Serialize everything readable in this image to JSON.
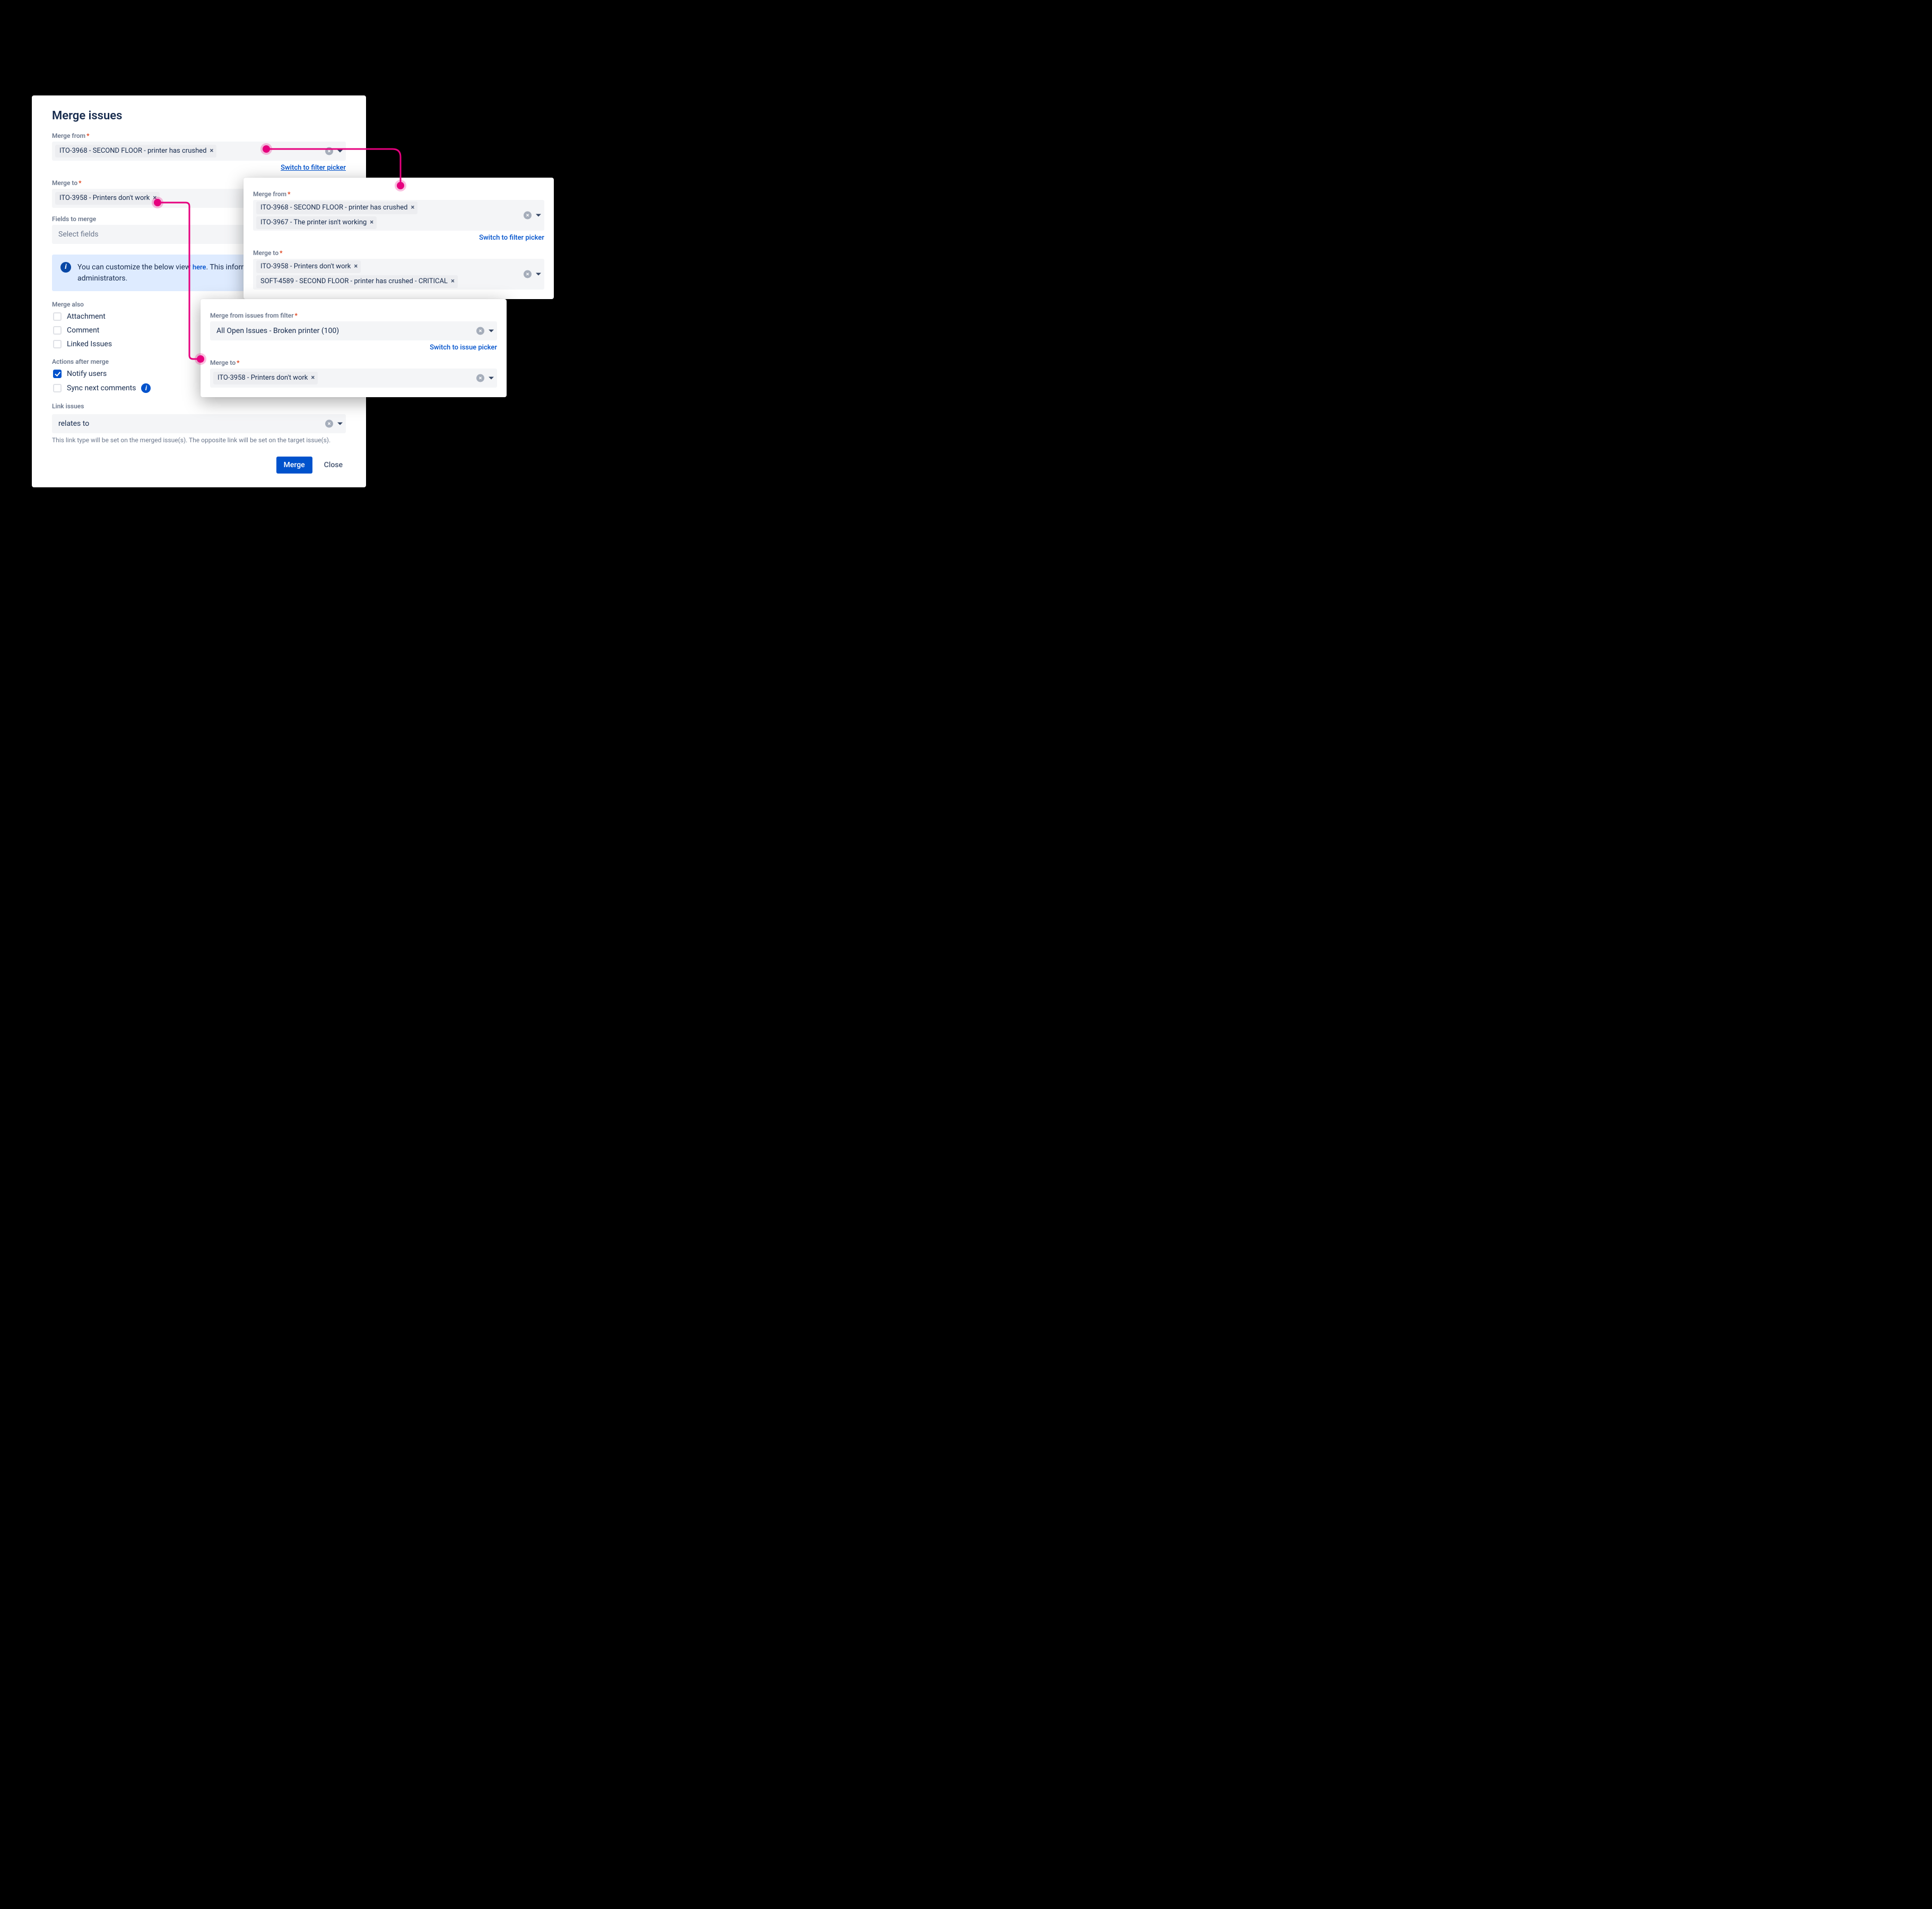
{
  "main": {
    "title": "Merge issues",
    "merge_from_label": "Merge from",
    "merge_from_chip_0": "ITO-3968 - SECOND FLOOR - printer has crushed",
    "switch_filter_link": "Switch to filter picker",
    "merge_to_label": "Merge to",
    "merge_to_chip_0": "ITO-3958 - Printers don't work",
    "fields_to_merge_label": "Fields to merge",
    "fields_placeholder": "Select fields",
    "info_text_prefix": "You can customize the below view ",
    "info_text_link": "here",
    "info_text_suffix": ". This information is visible only to administrators.",
    "merge_also_label": "Merge also",
    "merge_also_items": {
      "attachment": "Attachment",
      "comment": "Comment",
      "linked": "Linked Issues"
    },
    "actions_after_merge_label": "Actions after merge",
    "actions": {
      "notify": "Notify users",
      "sync": "Sync next comments"
    },
    "link_issues_label": "Link issues",
    "link_issues_value": "relates to",
    "link_help": "This link type will be set on the merged issue(s). The opposite link will be set on the target issue(s).",
    "merge_btn": "Merge",
    "close_btn": "Close"
  },
  "top_panel": {
    "merge_from_label": "Merge from",
    "merge_from_chips": {
      "c0": "ITO-3968 - SECOND FLOOR - printer has crushed",
      "c1": "ITO-3967 - The printer isn't working"
    },
    "switch_filter_link": "Switch to filter picker",
    "merge_to_label": "Merge to",
    "merge_to_chips": {
      "c0": "ITO-3958 - Printers don't work",
      "c1": "SOFT-4589 - SECOND FLOOR - printer has crushed - CRITICAL"
    }
  },
  "mid_panel": {
    "merge_from_filter_label": "Merge from issues from filter",
    "filter_value": "All Open Issues - Broken printer (100)",
    "switch_issue_link": "Switch to issue picker",
    "merge_to_label": "Merge to",
    "merge_to_chip_0": "ITO-3958 - Printers don't work"
  }
}
